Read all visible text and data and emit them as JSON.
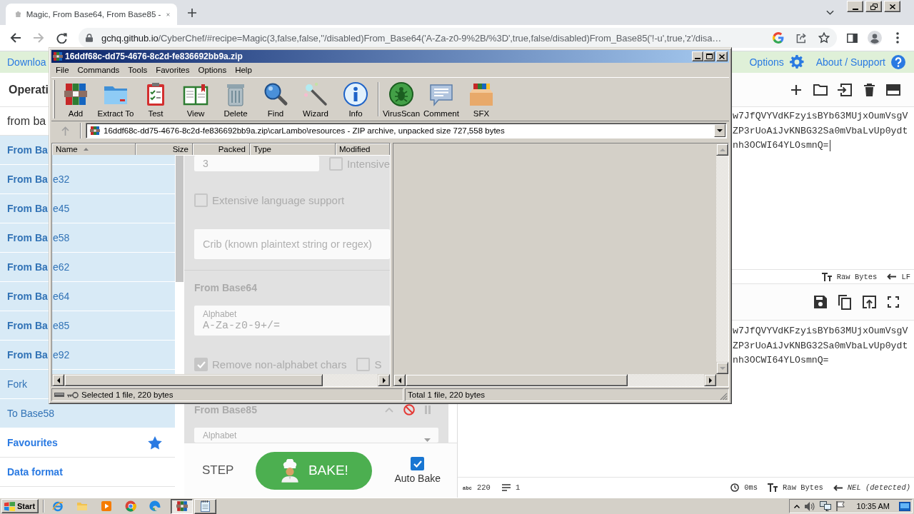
{
  "browser": {
    "tab_title": "Magic, From Base64, From Base85 -",
    "navigation": {
      "can_go_back": true,
      "can_go_forward": false
    },
    "url": {
      "host": "gchq.github.io",
      "path": "/CyberChef/#recipe=Magic(3,false,false,''/disabled)From_Base64('A-Za-z0-9%2B/%3D',true,false/disabled)From_Base85('!-u',true,'z'/disa…"
    }
  },
  "banner": {
    "download": "Downloa",
    "options": "Options",
    "about": "About / Support"
  },
  "archive_window": {
    "title": "16ddf68c-dd75-4676-8c2d-fe836692bb9a.zip",
    "menu": [
      "File",
      "Commands",
      "Tools",
      "Favorites",
      "Options",
      "Help"
    ],
    "toolbar": [
      [
        {
          "kind": "add",
          "label": "Add"
        },
        {
          "kind": "extract",
          "label": "Extract To"
        },
        {
          "kind": "test",
          "label": "Test"
        },
        {
          "kind": "view",
          "label": "View"
        },
        {
          "kind": "delete",
          "label": "Delete"
        },
        {
          "kind": "find",
          "label": "Find"
        },
        {
          "kind": "wizard",
          "label": "Wizard"
        },
        {
          "kind": "info",
          "label": "Info"
        }
      ],
      [
        {
          "kind": "virusscan",
          "label": "VirusScan"
        },
        {
          "kind": "comment",
          "label": "Comment"
        },
        {
          "kind": "sfx",
          "label": "SFX"
        }
      ]
    ],
    "up_enabled": false,
    "path": "16ddf68c-dd75-4676-8c2d-fe836692bb9a.zip\\carLambo\\resources - ZIP archive, unpacked size 727,558 bytes",
    "columns": [
      {
        "label": "Name",
        "sorted": true,
        "numeric": false
      },
      {
        "label": "Size",
        "sorted": false,
        "numeric": true
      },
      {
        "label": "Packed",
        "sorted": false,
        "numeric": true
      },
      {
        "label": "Type",
        "sorted": false,
        "numeric": false
      },
      {
        "label": "Modified",
        "sorted": false,
        "numeric": false
      }
    ],
    "status": {
      "selected": "Selected 1 file, 220 bytes",
      "total": "Total 1 file, 220 bytes"
    }
  },
  "sidebar": {
    "heading": "Operati",
    "search": {
      "value": "from ba"
    },
    "results": [
      {
        "label": "From Ba",
        "matched": true
      },
      {
        "label": "From Ba",
        "label_tail": "e32",
        "matched": true
      },
      {
        "label": "From Ba",
        "label_tail": "e45",
        "matched": true
      },
      {
        "label": "From Ba",
        "label_tail": "e58",
        "matched": true
      },
      {
        "label": "From Ba",
        "label_tail": "e62",
        "matched": true
      },
      {
        "label": "From Ba",
        "label_tail": "e64",
        "matched": true
      },
      {
        "label": "From Ba",
        "label_tail": "e85",
        "matched": true
      },
      {
        "label": "From Ba",
        "label_tail": "e92",
        "matched": true
      },
      {
        "label": "Fork",
        "matched": false
      },
      {
        "label": "To Base58",
        "matched": false
      }
    ],
    "categories": [
      {
        "label": "Favourites",
        "kind": "favourites"
      },
      {
        "label": "Data format",
        "kind": "category"
      }
    ]
  },
  "recipe": {
    "operations": [
      {
        "disabled": true,
        "rows": [
          [
            {
              "kind": "field",
              "value": "3"
            },
            {
              "kind": "checkbox",
              "label": "Intensive",
              "checked": false
            }
          ],
          [
            {
              "kind": "checkbox",
              "label": "Extensive language support",
              "checked": false
            }
          ],
          [
            {
              "kind": "field",
              "placeholder": "Crib (known plaintext string or regex)"
            }
          ]
        ]
      },
      {
        "name": "From Base64",
        "disabled": true,
        "rows": [
          [
            {
              "kind": "field",
              "label": "Alphabet",
              "value": "A-Za-z0-9+/="
            }
          ],
          [
            {
              "kind": "checkbox",
              "label": "Remove non-alphabet chars",
              "checked": true
            },
            {
              "kind": "checkbox",
              "label": "S",
              "checked": false
            }
          ]
        ]
      },
      {
        "name": "From Base85",
        "disabled": true,
        "rows": [
          [
            {
              "kind": "dropdown",
              "label": "Alphabet"
            }
          ]
        ]
      }
    ],
    "controls": {
      "step": "STEP",
      "bake": "BAKE!",
      "auto_bake": {
        "label": "Auto Bake",
        "checked": true
      }
    }
  },
  "input": {
    "focused": true,
    "lines": [
      "w7JfQVYVdKFzyisBYb63MUjxOumVsgV",
      "ZP3rUoAiJvKNBG32Sa0mVbaLvUp0ydt",
      "nh3OCWI64YLOsmnQ="
    ],
    "status": {
      "format": "Raw Bytes",
      "eol": "LF"
    }
  },
  "output": {
    "lines": [
      "w7JfQVYVdKFzyisBYb63MUjxOumVsgV",
      "ZP3rUoAiJvKNBG32Sa0mVbaLvUp0ydt",
      "nh3OCWI64YLOsmnQ="
    ],
    "status": {
      "length_icon": "abc",
      "length": "220",
      "lines": "1",
      "time": "0ms",
      "format": "Raw Bytes",
      "eol": "NEL (detected)"
    }
  },
  "taskbar": {
    "start": "Start",
    "tasks": [
      {
        "kind": "archiver",
        "selected": true
      },
      {
        "kind": "notepad",
        "selected": false
      }
    ],
    "clock": "10:35 AM"
  }
}
